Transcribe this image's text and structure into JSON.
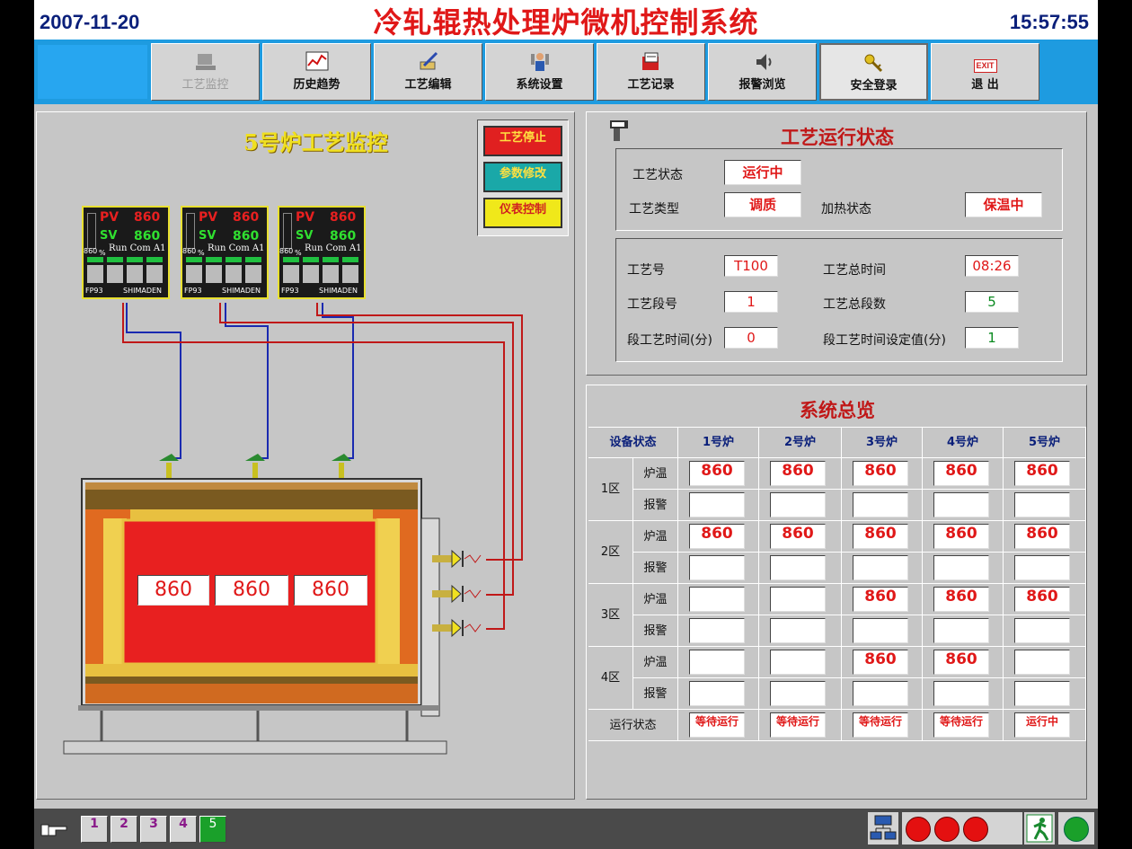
{
  "header": {
    "date": "2007-11-20",
    "title": "冷轧辊热处理炉微机控制系统",
    "time": "15:57:55"
  },
  "toolbar": [
    {
      "label": "工艺监控",
      "icon": "monitor-icon",
      "state": "disabled"
    },
    {
      "label": "历史趋势",
      "icon": "trend-chart-icon"
    },
    {
      "label": "工艺编辑",
      "icon": "edit-icon"
    },
    {
      "label": "系统设置",
      "icon": "settings-person-icon"
    },
    {
      "label": "工艺记录",
      "icon": "record-icon"
    },
    {
      "label": "报警浏览",
      "icon": "speaker-icon"
    },
    {
      "label": "安全登录",
      "icon": "key-icon",
      "state": "active"
    },
    {
      "label": "退  出",
      "icon": "exit-icon",
      "badge": "EXIT"
    }
  ],
  "monitor": {
    "title": "5号炉工艺监控",
    "buttons": [
      {
        "label": "工艺停止",
        "color": "#e02020"
      },
      {
        "label": "参数修改",
        "color": "#1aa8a8"
      },
      {
        "label": "仪表控制",
        "color": "#f0e81a"
      }
    ],
    "controllers": [
      {
        "pv_label": "PV",
        "pv": "860",
        "sv_label": "SV",
        "sv": "860",
        "status": "Run Com A1",
        "bar": "860",
        "unit": "%",
        "model": "FP93",
        "brand": "SHIMADEN"
      },
      {
        "pv_label": "PV",
        "pv": "860",
        "sv_label": "SV",
        "sv": "860",
        "status": "Run Com A1",
        "bar": "860",
        "unit": "%",
        "model": "FP93",
        "brand": "SHIMADEN"
      },
      {
        "pv_label": "PV",
        "pv": "860",
        "sv_label": "SV",
        "sv": "860",
        "status": "Run Com A1",
        "bar": "860",
        "unit": "%",
        "model": "FP93",
        "brand": "SHIMADEN"
      }
    ],
    "furnace_temps": [
      "860",
      "860",
      "860"
    ]
  },
  "process": {
    "title": "工艺运行状态",
    "status_label": "工艺状态",
    "status": "运行中",
    "type_label": "工艺类型",
    "type": "调质",
    "heat_label": "加热状态",
    "heat": "保温中",
    "no_label": "工艺号",
    "no": "T100",
    "total_time_label": "工艺总时间",
    "total_time": "08:26",
    "seg_label": "工艺段号",
    "seg": "1",
    "total_seg_label": "工艺总段数",
    "total_seg": "5",
    "seg_time_label": "段工艺时间(分)",
    "seg_time": "0",
    "seg_set_label": "段工艺时间设定值(分)",
    "seg_set": "1"
  },
  "overview": {
    "title": "系统总览",
    "corner": "设备状态",
    "furnaces": [
      "1号炉",
      "2号炉",
      "3号炉",
      "4号炉",
      "5号炉"
    ],
    "zones": [
      {
        "name": "1区",
        "temp_label": "炉温",
        "alarm_label": "报警",
        "temps": [
          "860",
          "860",
          "860",
          "860",
          "860"
        ]
      },
      {
        "name": "2区",
        "temp_label": "炉温",
        "alarm_label": "报警",
        "temps": [
          "860",
          "860",
          "860",
          "860",
          "860"
        ]
      },
      {
        "name": "3区",
        "temp_label": "炉温",
        "alarm_label": "报警",
        "temps": [
          "",
          "",
          "860",
          "860",
          "860"
        ]
      },
      {
        "name": "4区",
        "temp_label": "炉温",
        "alarm_label": "报警",
        "temps": [
          "",
          "",
          "860",
          "860",
          ""
        ]
      }
    ],
    "run_label": "运行状态",
    "run": [
      "等待运行",
      "等待运行",
      "等待运行",
      "等待运行",
      "运行中"
    ]
  },
  "footer": {
    "pages": [
      "1",
      "2",
      "3",
      "4",
      "5"
    ],
    "active_page": "5"
  },
  "colors": {
    "accent": "#1e9be0",
    "alarm": "#e41010",
    "ok": "#1aa02a",
    "title": "#e01818"
  }
}
